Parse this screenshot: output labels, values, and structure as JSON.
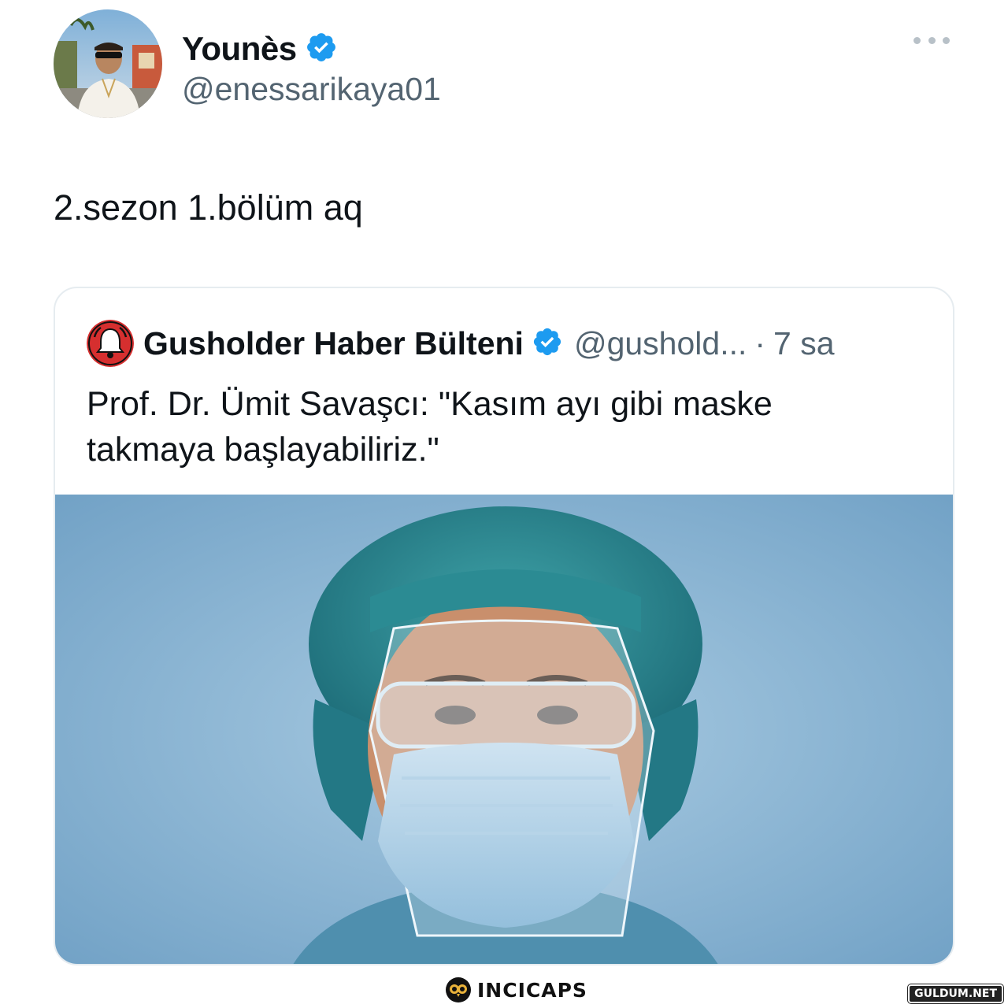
{
  "tweet": {
    "author_name": "Younès",
    "author_handle": "@enessarikaya01",
    "verified": true,
    "more_icon": "more-horizontal-icon",
    "text": "2.sezon 1.bölüm aq"
  },
  "quoted_tweet": {
    "author_name": "Gusholder Haber Bülteni",
    "author_handle": "@gushold...",
    "separator": "·",
    "time": "7 sa",
    "verified": true,
    "avatar_icon": "bell-icon",
    "text": "Prof. Dr. Ümit Savaşcı: \"Kasım ayı gibi maske takmaya başlayabiliriz.\"",
    "media_description": "photo-health-worker-face-shield-mask"
  },
  "footer": {
    "logo_text": "INCICAPS",
    "watermark_text": "GULDUM.NET"
  },
  "colors": {
    "text_primary": "#0f1419",
    "text_secondary": "#536471",
    "verified_blue": "#1d9bf0",
    "border": "#e6ecf0",
    "bell_red": "#d62f2f"
  }
}
